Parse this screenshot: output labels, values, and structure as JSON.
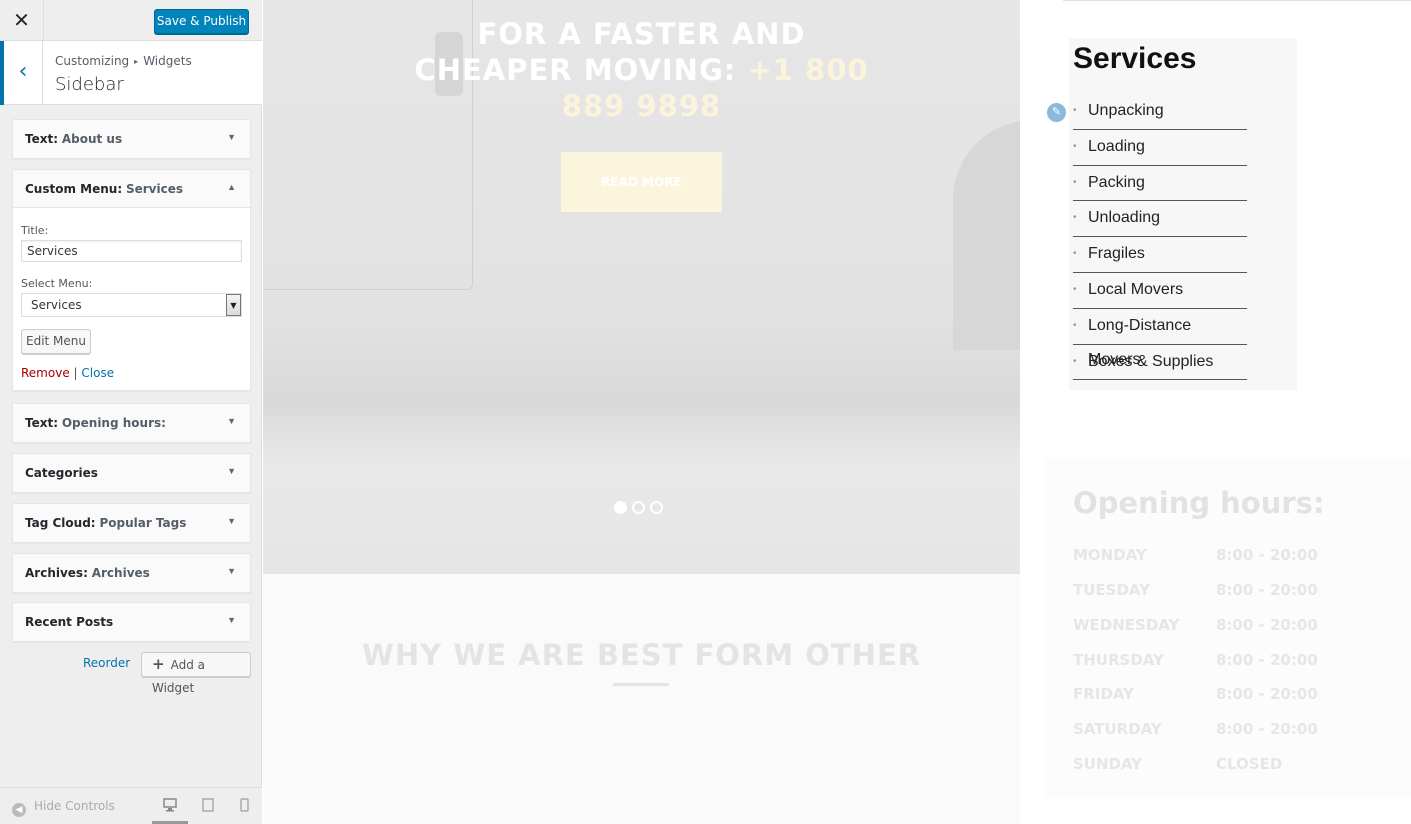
{
  "toolbar": {
    "close_label": "✕",
    "save_label": "Save & Publish"
  },
  "section": {
    "back_label": "‹",
    "crumb_root": "Customizing",
    "crumb_sep": "▸",
    "crumb_child": "Widgets",
    "title": "Sidebar"
  },
  "widgets": [
    {
      "type": "Text:",
      "name": "About us"
    },
    {
      "type": "Custom Menu:",
      "name": "Services"
    },
    {
      "type": "Text:",
      "name": "Opening hours:"
    },
    {
      "type": "Categories",
      "name": ""
    },
    {
      "type": "Tag Cloud:",
      "name": "Popular Tags"
    },
    {
      "type": "Archives:",
      "name": "Archives"
    },
    {
      "type": "Recent Posts",
      "name": ""
    }
  ],
  "form": {
    "title_label": "Title:",
    "title_value": "Services",
    "select_label": "Select Menu:",
    "select_value": "Services",
    "edit_menu_label": "Edit Menu",
    "remove_label": "Remove",
    "divider": "|",
    "close_label": "Close"
  },
  "actions": {
    "reorder_label": "Reorder",
    "add_widget_label": "Add a Widget"
  },
  "footer": {
    "hide_controls_label": "Hide Controls"
  },
  "hero": {
    "line1": "FOR A FASTER AND",
    "line2": "CHEAPER MOVING:",
    "phone_a": "+1 800",
    "phone_b": "889 9898",
    "read_more": "READ MORE"
  },
  "why": {
    "title": "WHY WE ARE BEST FORM OTHER"
  },
  "services": {
    "title": "Services",
    "items": [
      "Unpacking",
      "Loading",
      "Packing",
      "Unloading",
      "Fragiles",
      "Local Movers",
      "Long-Distance Movers",
      "Boxes & Supplies"
    ]
  },
  "opening": {
    "title": "Opening hours:",
    "rows": [
      {
        "day": "MONDAY",
        "time": "8:00 - 20:00"
      },
      {
        "day": "TUESDAY",
        "time": "8:00 - 20:00"
      },
      {
        "day": "WEDNESDAY",
        "time": "8:00 - 20:00"
      },
      {
        "day": "THURSDAY",
        "time": "8:00 - 20:00"
      },
      {
        "day": "FRIDAY",
        "time": "8:00 - 20:00"
      },
      {
        "day": "SATURDAY",
        "time": "8:00 - 20:00"
      },
      {
        "day": "SUNDAY",
        "time": "CLOSED"
      }
    ]
  },
  "colors": {
    "accent": "#0085ba",
    "link": "#0073aa",
    "remove": "#aa0000",
    "panel_bg": "#eeeeee"
  },
  "icons": {
    "close": "close-icon",
    "back": "chevron-left-icon",
    "add": "plus-icon",
    "edit": "pencil-icon"
  }
}
